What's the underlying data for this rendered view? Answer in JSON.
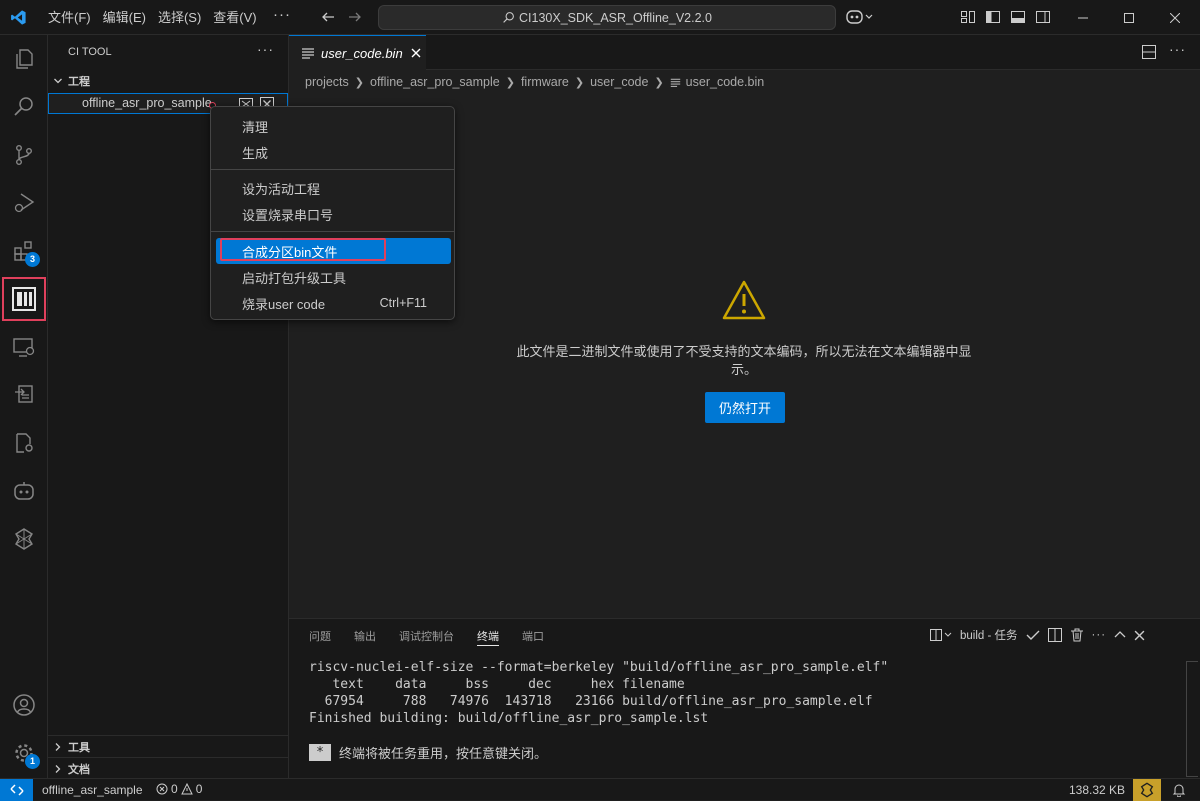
{
  "titlebar": {
    "menus": [
      "文件(F)",
      "编辑(E)",
      "选择(S)",
      "查看(V)"
    ],
    "more": "···",
    "search_text": "CI130X_SDK_ASR_Offline_V2.2.0"
  },
  "sidebar": {
    "title": "CI TOOL",
    "more": "···",
    "section_projects": "工程",
    "project_item": "offline_asr_pro_sample",
    "section_tools": "工具",
    "section_docs": "文档"
  },
  "activity_badges": {
    "extensions": "3",
    "settings": "1"
  },
  "editor": {
    "tab_label": "user_code.bin",
    "breadcrumb": [
      "projects",
      "offline_asr_pro_sample",
      "firmware",
      "user_code",
      "user_code.bin"
    ],
    "binary_message": "此文件是二进制文件或使用了不受支持的文本编码，所以无法在文本编辑器中显示。",
    "open_anyway": "仍然打开"
  },
  "panel": {
    "tabs": [
      "问题",
      "输出",
      "调试控制台",
      "终端",
      "端口"
    ],
    "active_tab": "终端",
    "task_label": "build - 任务",
    "terminal_lines": [
      "riscv-nuclei-elf-size --format=berkeley \"build/offline_asr_pro_sample.elf\"",
      "   text    data     bss     dec     hex filename",
      "  67954     788   74976  143718   23166 build/offline_asr_pro_sample.elf",
      "Finished building: build/offline_asr_pro_sample.lst"
    ],
    "reuse_star": "*",
    "reuse_message": "终端将被任务重用，按任意键关闭。"
  },
  "context_menu": {
    "clean": "清理",
    "build": "生成",
    "set_active": "设为活动工程",
    "set_port": "设置烧录串口号",
    "merge_bin": "合成分区bin文件",
    "launch_pack": "启动打包升级工具",
    "flash_user": "烧录user code",
    "flash_shortcut": "Ctrl+F11"
  },
  "statusbar": {
    "project": "offline_asr_sample",
    "errors": "0",
    "warnings": "0",
    "file_size": "138.32 KB"
  },
  "colors": {
    "accent": "#0078d4",
    "highlight": "#e0405c",
    "warning": "#cca700"
  }
}
